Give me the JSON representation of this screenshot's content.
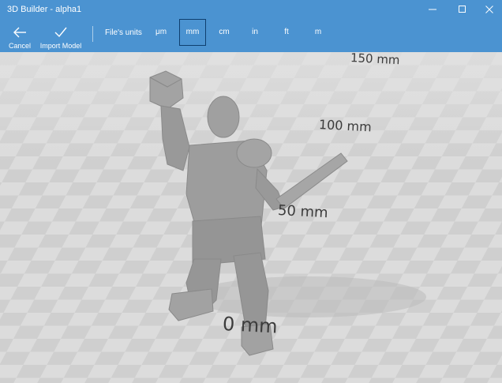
{
  "window": {
    "title": "3D Builder - alpha1"
  },
  "toolbar": {
    "cancel_label": "Cancel",
    "import_label": "Import Model",
    "units_label": "File's units",
    "units": [
      "μm",
      "mm",
      "cm",
      "in",
      "ft",
      "m"
    ],
    "selected_unit": "mm"
  },
  "viewport": {
    "scale_labels": [
      "150 mm",
      "100 mm",
      "50 mm",
      "0 mm"
    ]
  },
  "colors": {
    "accent": "#4b93d1",
    "floor_light": "#dcdcdc",
    "floor_dark": "#c9c9c9",
    "model": "#9b9b9b"
  }
}
